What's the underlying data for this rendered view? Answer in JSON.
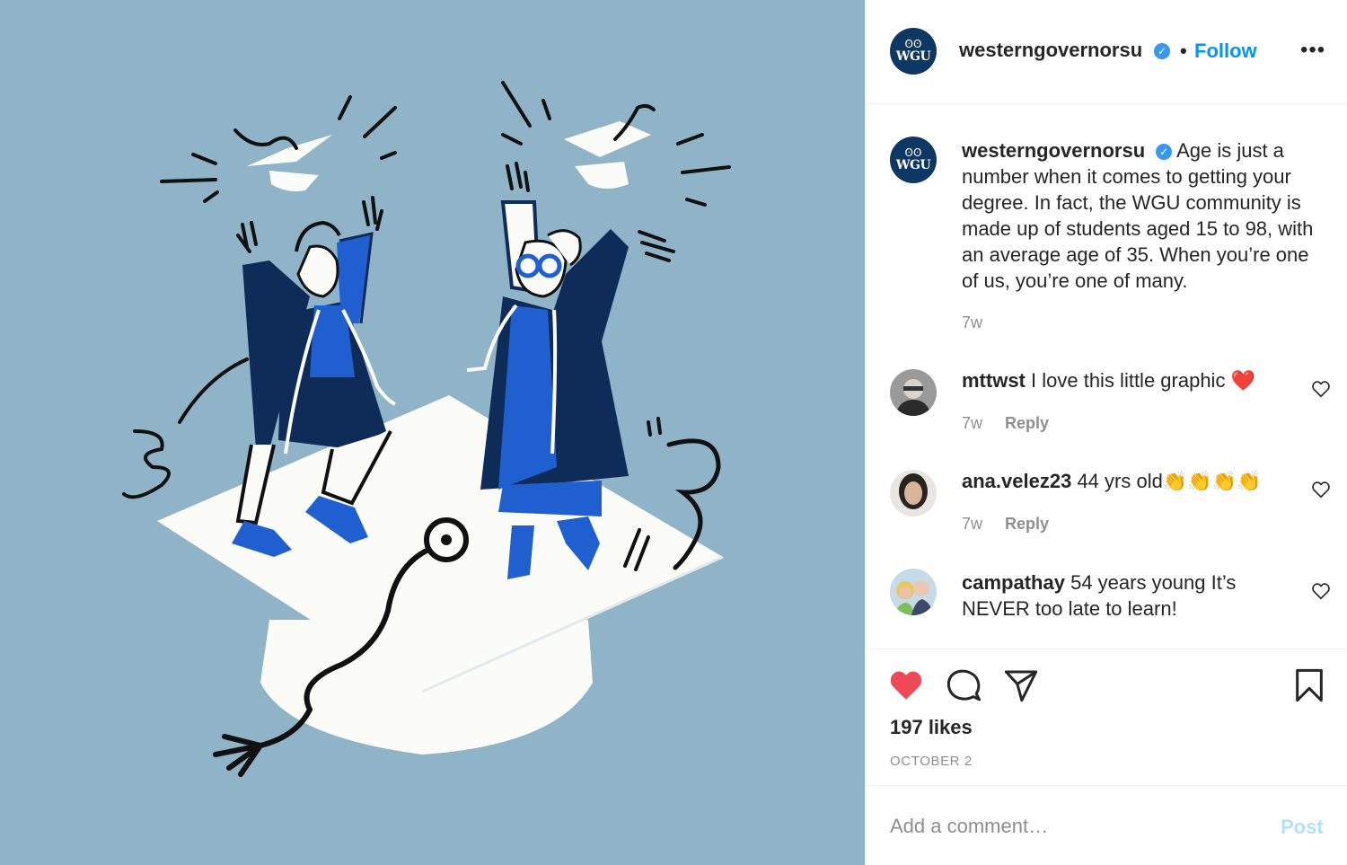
{
  "colors": {
    "media_bg": "#8fb3c7",
    "navy": "#0f3764",
    "blue": "#1f5fd0",
    "follow_blue": "#0095f6",
    "like_red": "#ed4956",
    "muted": "#8e8e8e"
  },
  "header": {
    "avatar_text": "WGU",
    "username": "westerngovernorsu",
    "verified_icon": "verified-badge-icon",
    "separator": "•",
    "follow_label": "Follow",
    "more_icon": "more-options-icon",
    "more_glyph": "•••"
  },
  "caption": {
    "avatar_text": "WGU",
    "username": "westerngovernorsu",
    "text": "Age is just a number when it comes to getting your degree. In fact, the WGU community is made up of students aged 15 to 98, with an average age of 35. When you’re one of us, you’re one of many.",
    "time": "7w"
  },
  "comments": [
    {
      "username": "mttwst",
      "text": "I love this little graphic ❤️",
      "time": "7w",
      "reply_label": "Reply"
    },
    {
      "username": "ana.velez23",
      "text": "44 yrs old👏👏👏👏",
      "time": "7w",
      "reply_label": "Reply"
    },
    {
      "username": "campathay",
      "text": "54 years young It’s NEVER too late to learn!"
    }
  ],
  "actions": {
    "like_icon": "heart-filled-icon",
    "comment_icon": "comment-bubble-icon",
    "share_icon": "paper-plane-icon",
    "save_icon": "bookmark-icon",
    "likes": "197 likes",
    "date": "OCTOBER 2"
  },
  "add_comment": {
    "placeholder": "Add a comment…",
    "post_label": "Post"
  }
}
